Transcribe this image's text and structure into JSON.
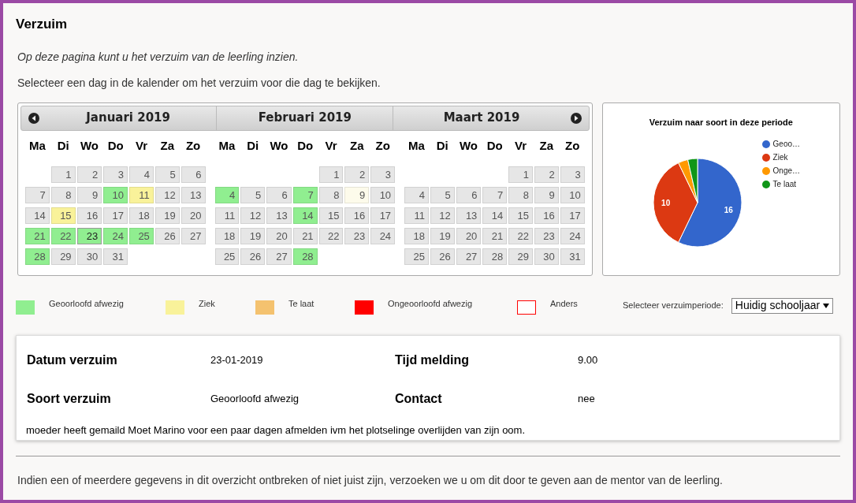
{
  "title": "Verzuim",
  "intro": "Op deze pagina kunt u het verzuim van de leerling inzien.",
  "instruction": "Selecteer een dag in de kalender om het verzuim voor die dag te bekijken.",
  "calendar": {
    "months": [
      {
        "title": "Januari 2019",
        "weekdays": [
          "Ma",
          "Di",
          "Wo",
          "Do",
          "Vr",
          "Za",
          "Zo"
        ],
        "weeks": [
          {
            "days": [
              {
                "day": "1",
                "color": "#e6e6e6",
                "selected": false
              },
              {
                "day": "2",
                "color": "#e6e6e6",
                "selected": false
              },
              {
                "day": "3",
                "color": "#e6e6e6",
                "selected": false
              },
              {
                "day": "4",
                "color": "#e6e6e6",
                "selected": false
              },
              {
                "day": "5",
                "color": "#e6e6e6",
                "selected": false
              },
              {
                "day": "6",
                "color": "#e6e6e6",
                "selected": false
              }
            ]
          },
          {
            "days": [
              {
                "day": "7",
                "color": "#e6e6e6",
                "selected": false
              },
              {
                "day": "8",
                "color": "#e6e6e6",
                "selected": false
              },
              {
                "day": "9",
                "color": "#e6e6e6",
                "selected": false
              },
              {
                "day": "10",
                "color": "#90ee90",
                "selected": false
              },
              {
                "day": "11",
                "color": "#f9f29a",
                "selected": false
              },
              {
                "day": "12",
                "color": "#e6e6e6",
                "selected": false
              },
              {
                "day": "13",
                "color": "#e6e6e6",
                "selected": false
              }
            ]
          },
          {
            "days": [
              {
                "day": "14",
                "color": "#e6e6e6",
                "selected": false
              },
              {
                "day": "15",
                "color": "#f9f29a",
                "selected": false
              },
              {
                "day": "16",
                "color": "#e6e6e6",
                "selected": false
              },
              {
                "day": "17",
                "color": "#e6e6e6",
                "selected": false
              },
              {
                "day": "18",
                "color": "#e6e6e6",
                "selected": false
              },
              {
                "day": "19",
                "color": "#e6e6e6",
                "selected": false
              },
              {
                "day": "20",
                "color": "#e6e6e6",
                "selected": false
              }
            ]
          },
          {
            "days": [
              {
                "day": "21",
                "color": "#90ee90",
                "selected": false
              },
              {
                "day": "22",
                "color": "#90ee90",
                "selected": false
              },
              {
                "day": "23",
                "color": "#90ee90",
                "selected": true
              },
              {
                "day": "24",
                "color": "#90ee90",
                "selected": false
              },
              {
                "day": "25",
                "color": "#90ee90",
                "selected": false
              },
              {
                "day": "26",
                "color": "#e6e6e6",
                "selected": false
              },
              {
                "day": "27",
                "color": "#e6e6e6",
                "selected": false
              }
            ]
          },
          {
            "days": [
              {
                "day": "28",
                "color": "#90ee90",
                "selected": false
              },
              {
                "day": "29",
                "color": "#e6e6e6",
                "selected": false
              },
              {
                "day": "30",
                "color": "#e6e6e6",
                "selected": false
              },
              {
                "day": "31",
                "color": "#e6e6e6",
                "selected": false
              }
            ]
          }
        ]
      },
      {
        "title": "Februari 2019",
        "weekdays": [
          "Ma",
          "Di",
          "Wo",
          "Do",
          "Vr",
          "Za",
          "Zo"
        ],
        "weeks": [
          {
            "days": [
              {
                "day": "1",
                "color": "#e6e6e6",
                "selected": false
              },
              {
                "day": "2",
                "color": "#e6e6e6",
                "selected": false
              },
              {
                "day": "3",
                "color": "#e6e6e6",
                "selected": false
              }
            ]
          },
          {
            "days": [
              {
                "day": "4",
                "color": "#90ee90",
                "selected": false
              },
              {
                "day": "5",
                "color": "#e6e6e6",
                "selected": false
              },
              {
                "day": "6",
                "color": "#e6e6e6",
                "selected": false
              },
              {
                "day": "7",
                "color": "#90ee90",
                "selected": false
              },
              {
                "day": "8",
                "color": "#e6e6e6",
                "selected": false
              },
              {
                "day": "9",
                "color": "#fdfbeb",
                "selected": false
              },
              {
                "day": "10",
                "color": "#e6e6e6",
                "selected": false
              }
            ]
          },
          {
            "days": [
              {
                "day": "11",
                "color": "#e6e6e6",
                "selected": false
              },
              {
                "day": "12",
                "color": "#e6e6e6",
                "selected": false
              },
              {
                "day": "13",
                "color": "#e6e6e6",
                "selected": false
              },
              {
                "day": "14",
                "color": "#90ee90",
                "selected": false
              },
              {
                "day": "15",
                "color": "#e6e6e6",
                "selected": false
              },
              {
                "day": "16",
                "color": "#e6e6e6",
                "selected": false
              },
              {
                "day": "17",
                "color": "#e6e6e6",
                "selected": false
              }
            ]
          },
          {
            "days": [
              {
                "day": "18",
                "color": "#e6e6e6",
                "selected": false
              },
              {
                "day": "19",
                "color": "#e6e6e6",
                "selected": false
              },
              {
                "day": "20",
                "color": "#e6e6e6",
                "selected": false
              },
              {
                "day": "21",
                "color": "#e6e6e6",
                "selected": false
              },
              {
                "day": "22",
                "color": "#e6e6e6",
                "selected": false
              },
              {
                "day": "23",
                "color": "#e6e6e6",
                "selected": false
              },
              {
                "day": "24",
                "color": "#e6e6e6",
                "selected": false
              }
            ]
          },
          {
            "days": [
              {
                "day": "25",
                "color": "#e6e6e6",
                "selected": false
              },
              {
                "day": "26",
                "color": "#e6e6e6",
                "selected": false
              },
              {
                "day": "27",
                "color": "#e6e6e6",
                "selected": false
              },
              {
                "day": "28",
                "color": "#90ee90",
                "selected": false
              }
            ]
          }
        ]
      },
      {
        "title": "Maart 2019",
        "weekdays": [
          "Ma",
          "Di",
          "Wo",
          "Do",
          "Vr",
          "Za",
          "Zo"
        ],
        "weeks": [
          {
            "days": [
              {
                "day": "1",
                "color": "#e6e6e6",
                "selected": false
              },
              {
                "day": "2",
                "color": "#e6e6e6",
                "selected": false
              },
              {
                "day": "3",
                "color": "#e6e6e6",
                "selected": false
              }
            ]
          },
          {
            "days": [
              {
                "day": "4",
                "color": "#e6e6e6",
                "selected": false
              },
              {
                "day": "5",
                "color": "#e6e6e6",
                "selected": false
              },
              {
                "day": "6",
                "color": "#e6e6e6",
                "selected": false
              },
              {
                "day": "7",
                "color": "#e6e6e6",
                "selected": false
              },
              {
                "day": "8",
                "color": "#e6e6e6",
                "selected": false
              },
              {
                "day": "9",
                "color": "#e6e6e6",
                "selected": false
              },
              {
                "day": "10",
                "color": "#e6e6e6",
                "selected": false
              }
            ]
          },
          {
            "days": [
              {
                "day": "11",
                "color": "#e6e6e6",
                "selected": false
              },
              {
                "day": "12",
                "color": "#e6e6e6",
                "selected": false
              },
              {
                "day": "13",
                "color": "#e6e6e6",
                "selected": false
              },
              {
                "day": "14",
                "color": "#e6e6e6",
                "selected": false
              },
              {
                "day": "15",
                "color": "#e6e6e6",
                "selected": false
              },
              {
                "day": "16",
                "color": "#e6e6e6",
                "selected": false
              },
              {
                "day": "17",
                "color": "#e6e6e6",
                "selected": false
              }
            ]
          },
          {
            "days": [
              {
                "day": "18",
                "color": "#e6e6e6",
                "selected": false
              },
              {
                "day": "19",
                "color": "#e6e6e6",
                "selected": false
              },
              {
                "day": "20",
                "color": "#e6e6e6",
                "selected": false
              },
              {
                "day": "21",
                "color": "#e6e6e6",
                "selected": false
              },
              {
                "day": "22",
                "color": "#e6e6e6",
                "selected": false
              },
              {
                "day": "23",
                "color": "#e6e6e6",
                "selected": false
              },
              {
                "day": "24",
                "color": "#e6e6e6",
                "selected": false
              }
            ]
          },
          {
            "days": [
              {
                "day": "25",
                "color": "#e6e6e6",
                "selected": false
              },
              {
                "day": "26",
                "color": "#e6e6e6",
                "selected": false
              },
              {
                "day": "27",
                "color": "#e6e6e6",
                "selected": false
              },
              {
                "day": "28",
                "color": "#e6e6e6",
                "selected": false
              },
              {
                "day": "29",
                "color": "#e6e6e6",
                "selected": false
              },
              {
                "day": "30",
                "color": "#e6e6e6",
                "selected": false
              },
              {
                "day": "31",
                "color": "#e6e6e6",
                "selected": false
              }
            ]
          }
        ]
      }
    ]
  },
  "chart": {
    "chart_data": {
      "type": "pie",
      "title": "Verzuim naar soort in deze periode",
      "categories": [
        "Geoo…",
        "Ziek",
        "Onge…",
        "Te laat"
      ],
      "series": [
        {
          "values": [
            57.15,
            35.71,
            3.57,
            3.57
          ]
        }
      ],
      "colors": [
        "#3366cc",
        "#dc3912",
        "#ff9900",
        "#109618"
      ],
      "value_labels": [
        "16",
        "10",
        null,
        null
      ],
      "legend": "right"
    }
  },
  "legend": [
    {
      "label": "Geoorloofd afwezig",
      "color": "#90ee90",
      "kind": "filled"
    },
    {
      "label": "Ziek",
      "color": "#f9f29a",
      "kind": "filled"
    },
    {
      "label": "Te laat",
      "color": "#f4c26f",
      "kind": "filled"
    },
    {
      "label": "Ongeoorloofd afwezig",
      "color": "#ff0000",
      "kind": "filled"
    },
    {
      "label": "Anders",
      "color": "#ff0000",
      "kind": "outline"
    }
  ],
  "period": {
    "label": "Selecteer verzuimperiode:",
    "value": "Huidig schooljaar"
  },
  "detail": {
    "fields": [
      {
        "label": "Datum verzuim",
        "value": "23-01-2019"
      },
      {
        "label": "Tijd melding",
        "value": "9.00"
      },
      {
        "label": "Soort verzuim",
        "value": "Geoorloofd afwezig"
      },
      {
        "label": "Contact",
        "value": "nee"
      }
    ],
    "note": "moeder heeft gemaild Moet Marino voor een paar dagen afmelden ivm het plotselinge overlijden van zijn oom."
  },
  "footer": "Indien een of meerdere gegevens in dit overzicht ontbreken of niet juist zijn, verzoeken we u om dit door te geven aan de mentor van de leerling."
}
